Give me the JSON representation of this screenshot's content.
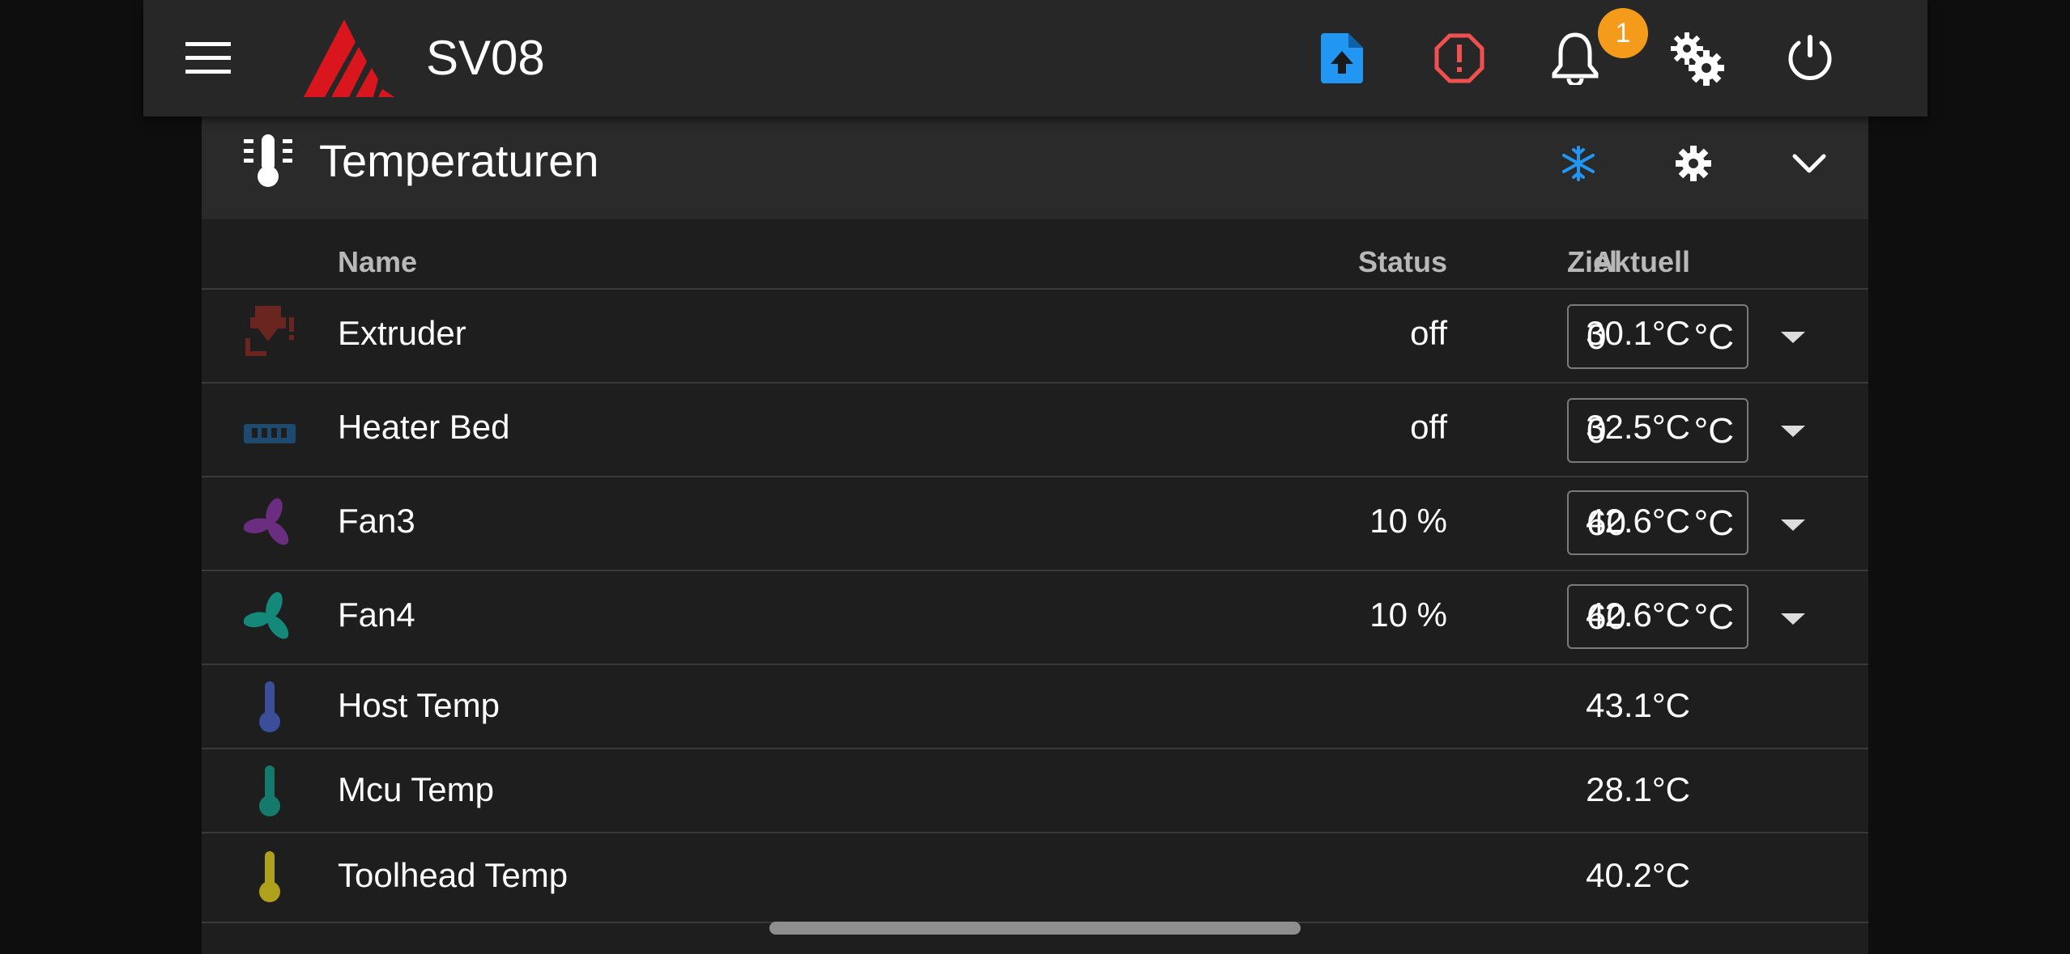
{
  "topbar": {
    "title": "SV08",
    "notification_count": "1",
    "icons": [
      "menu-icon",
      "printer-logo",
      "file-upload-icon",
      "emergency-stop-icon",
      "bell-icon",
      "cogs-icon",
      "power-icon"
    ]
  },
  "panel": {
    "title": "Temperaturen",
    "header_icons": [
      "thermometer-lines-icon",
      "snowflake-icon",
      "gear-icon",
      "chevron-down-icon"
    ]
  },
  "table": {
    "columns": {
      "name": "Name",
      "status": "Status",
      "current": "Aktuell",
      "target": "Ziel"
    },
    "rows": [
      {
        "icon": "extruder-icon",
        "icon_color": "#6b2520",
        "name": "Extruder",
        "status": "off",
        "current": "30.1°C",
        "target": "0",
        "unit": "°C"
      },
      {
        "icon": "heater-bed-icon",
        "icon_color": "#1f4a70",
        "name": "Heater Bed",
        "status": "off",
        "current": "32.5°C",
        "target": "0",
        "unit": "°C"
      },
      {
        "icon": "fan-icon",
        "icon_color": "#6b2d80",
        "name": "Fan3",
        "status": "10 %",
        "current": "42.6°C",
        "target": "60",
        "unit": "°C"
      },
      {
        "icon": "fan-icon",
        "icon_color": "#14897a",
        "name": "Fan4",
        "status": "10 %",
        "current": "42.6°C",
        "target": "60",
        "unit": "°C"
      },
      {
        "icon": "thermometer-icon",
        "icon_color": "#3b4e9a",
        "name": "Host Temp",
        "status": "",
        "current": "43.1°C"
      },
      {
        "icon": "thermometer-icon",
        "icon_color": "#147a6b",
        "name": "Mcu Temp",
        "status": "",
        "current": "28.1°C"
      },
      {
        "icon": "thermometer-icon",
        "icon_color": "#b0a11c",
        "name": "Toolhead Temp",
        "status": "",
        "current": "40.2°C"
      }
    ]
  },
  "colors": {
    "topbar_bg": "#272727",
    "panel_bg": "#1e1e1e",
    "panel_header_bg": "#2a2a2a",
    "accent_blue": "#2196f3",
    "danger_red": "#f05050",
    "badge_orange": "#f59b1c",
    "brand_red": "#d9161e"
  }
}
